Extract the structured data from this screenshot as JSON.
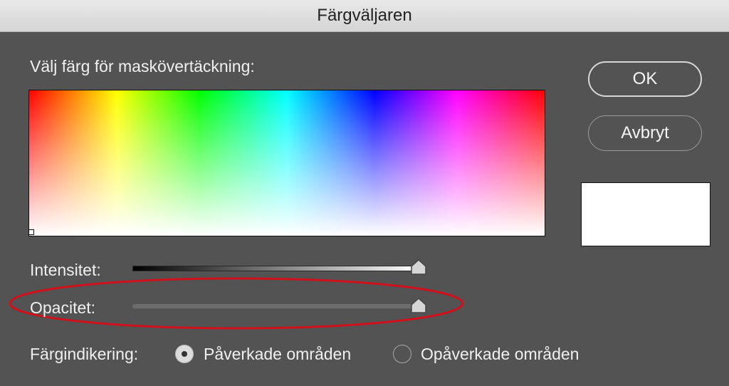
{
  "window": {
    "title": "Färgväljaren"
  },
  "picker": {
    "prompt": "Välj färg för maskövertäckning:"
  },
  "buttons": {
    "ok_label": "OK",
    "cancel_label": "Avbryt"
  },
  "selected_color": "#ffffff",
  "sliders": {
    "intensity": {
      "label": "Intensitet:",
      "value_fraction": 1.0
    },
    "opacity": {
      "label": "Opacitet:",
      "value_fraction": 1.0
    }
  },
  "color_indication": {
    "label": "Färgindikering:",
    "options": [
      {
        "label": "Påverkade områden",
        "selected": true
      },
      {
        "label": "Opåverkade områden",
        "selected": false
      }
    ]
  },
  "annotation": {
    "highlight_color": "#d0101a"
  }
}
